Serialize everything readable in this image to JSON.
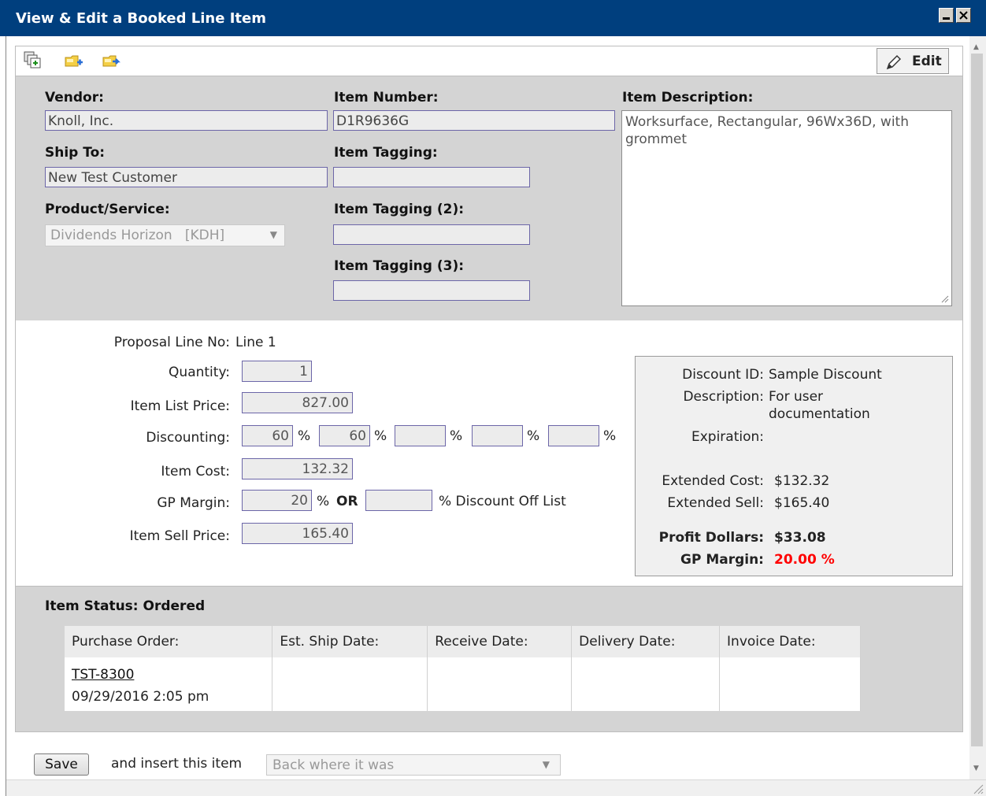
{
  "window": {
    "title": "View & Edit a Booked Line Item"
  },
  "toolbar": {
    "icons": [
      "copy-icon",
      "folder-add-icon",
      "folder-move-icon"
    ],
    "edit_label": "Edit"
  },
  "item": {
    "vendor_label": "Vendor:",
    "vendor_value": "Knoll, Inc.",
    "ship_to_label": "Ship To:",
    "ship_to_value": "New Test Customer",
    "product_label": "Product/Service:",
    "product_value": "Dividends Horizon   [KDH]",
    "item_number_label": "Item Number:",
    "item_number_value": "D1R9636G",
    "tagging_label": "Item Tagging:",
    "tagging_value": "",
    "tagging2_label": "Item Tagging (2):",
    "tagging2_value": "",
    "tagging3_label": "Item Tagging (3):",
    "tagging3_value": "",
    "description_label": "Item Description:",
    "description_value": "Worksurface, Rectangular, 96Wx36D, with grommet"
  },
  "pricing": {
    "proposal_line_label": "Proposal Line No:",
    "proposal_line_value": "Line 1",
    "quantity_label": "Quantity:",
    "quantity_value": "1",
    "list_price_label": "Item List Price:",
    "list_price_value": "827.00",
    "discounting_label": "Discounting:",
    "discounts": [
      "60",
      "60",
      "",
      "",
      ""
    ],
    "pct_symbol": "%",
    "item_cost_label": "Item Cost:",
    "item_cost_value": "132.32",
    "gp_margin_label": "GP Margin:",
    "gp_margin_value": "20",
    "or_label": "OR",
    "discount_off_list_value": "",
    "discount_off_list_label": "% Discount Off List",
    "sell_price_label": "Item Sell Price:",
    "sell_price_value": "165.40"
  },
  "summary": {
    "discount_id_label": "Discount ID:",
    "discount_id_value": "Sample Discount",
    "description_label": "Description:",
    "description_value_1": "For user",
    "description_value_2": "documentation",
    "expiration_label": "Expiration:",
    "expiration_value": "",
    "ext_cost_label": "Extended Cost:",
    "ext_cost_value": "$132.32",
    "ext_sell_label": "Extended Sell:",
    "ext_sell_value": "$165.40",
    "profit_label": "Profit Dollars:",
    "profit_value": "$33.08",
    "gp_margin_label": "GP Margin:",
    "gp_margin_value": "20.00 %",
    "gp_margin_color": "#ff0000"
  },
  "status": {
    "title": "Item Status: Ordered",
    "columns": [
      "Purchase Order:",
      "Est. Ship Date:",
      "Receive Date:",
      "Delivery Date:",
      "Invoice Date:"
    ],
    "po_number": "TST-8300",
    "po_date": "09/29/2016 2:05 pm"
  },
  "footer": {
    "save_label": "Save",
    "insert_label": "and insert this item",
    "insert_value": "Back where it was"
  },
  "colors": {
    "titlebar": "#003f7e",
    "panel": "#d4d4d4",
    "field_border": "#6c66a8"
  }
}
